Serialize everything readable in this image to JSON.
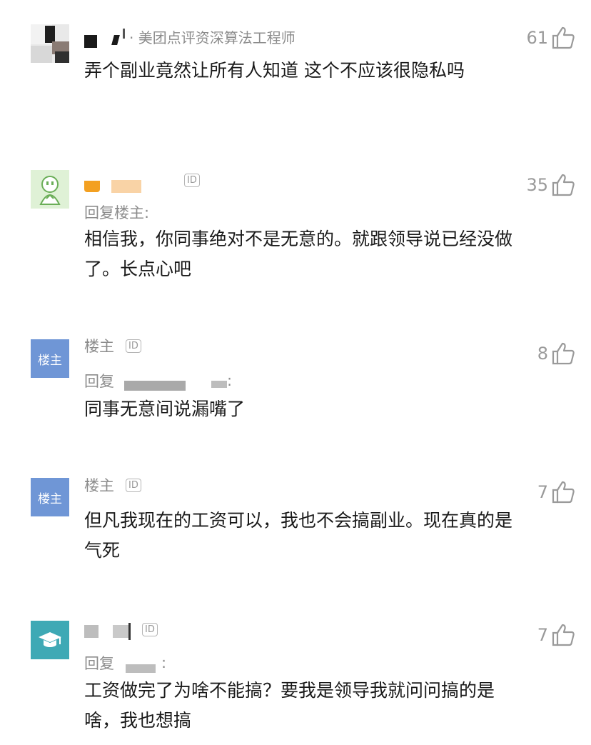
{
  "comments": [
    {
      "meta": "· 美团点评资深算法工程师",
      "text": "弄个副业竟然让所有人知道 这个不应该很隐私吗",
      "likes": "61"
    },
    {
      "id_badge": "ID",
      "reply_to": "回复楼主:",
      "text": "相信我，你同事绝对不是无意的。就跟领导说已经没做了。长点心吧",
      "likes": "35"
    },
    {
      "avatar_label": "楼主",
      "name": "楼主",
      "id_badge": "ID",
      "reply_prefix": "回复",
      "text": "同事无意间说漏嘴了",
      "likes": "8"
    },
    {
      "avatar_label": "楼主",
      "name": "楼主",
      "id_badge": "ID",
      "text": "但凡我现在的工资可以，我也不会搞副业。现在真的是气死",
      "likes": "7"
    },
    {
      "id_badge": "ID",
      "reply_prefix": "回复",
      "text": "工资做完了为啥不能搞？要我是领导我就问问搞的是啥，我也想搞",
      "likes": "7"
    }
  ],
  "icons": {
    "like": "thumbs-up-icon",
    "id": "id-badge-icon"
  }
}
